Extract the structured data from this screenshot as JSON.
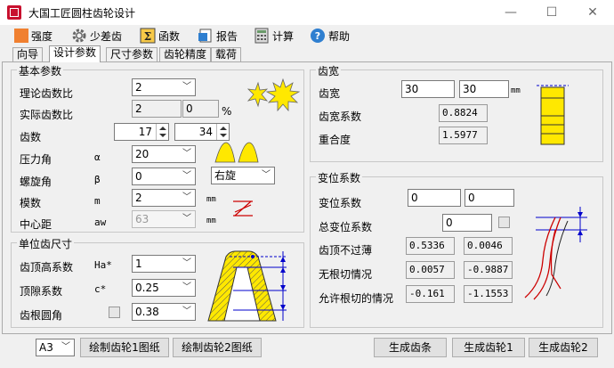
{
  "window": {
    "title": "大国工匠圆柱齿轮设计"
  },
  "toolbar": [
    {
      "label": "强度",
      "icon": "orange-square-icon"
    },
    {
      "label": "少差齿",
      "icon": "gear-icon"
    },
    {
      "label": "函数",
      "icon": "sigma-icon"
    },
    {
      "label": "报告",
      "icon": "report-icon"
    },
    {
      "label": "计算",
      "icon": "calculator-icon"
    },
    {
      "label": "帮助",
      "icon": "help-icon"
    }
  ],
  "tabs": [
    "向导",
    "设计参数",
    "尺寸参数",
    "齿轮精度",
    "载荷"
  ],
  "basic": {
    "title": "基本参数",
    "ratio_theory_label": "理论齿数比",
    "ratio_theory_value": "2",
    "ratio_actual_label": "实际齿数比",
    "ratio_actual_value": "2",
    "ratio_actual_pct": "0",
    "pct_unit": "%",
    "teeth_label": "齿数",
    "teeth_1": "17",
    "teeth_2": "34",
    "pressure_label": "压力角",
    "pressure_sym": "α",
    "pressure_value": "20",
    "helix_label": "螺旋角",
    "helix_sym": "β",
    "helix_value": "0",
    "hand_value": "右旋",
    "module_label": "模数",
    "module_sym": "m",
    "module_value": "2",
    "module_unit": "mm",
    "center_label": "中心距",
    "center_sym": "aw",
    "center_value": "63",
    "center_unit": "mm"
  },
  "unit_tooth": {
    "title": "单位齿尺寸",
    "addendum_label": "齿顶高系数",
    "addendum_sym": "Ha*",
    "addendum_value": "1",
    "clearance_label": "顶隙系数",
    "clearance_sym": "c*",
    "clearance_value": "0.25",
    "fillet_label": "齿根圆角",
    "fillet_value": "0.38"
  },
  "facewidth": {
    "title": "齿宽",
    "width_label": "齿宽",
    "width_1": "30",
    "width_2": "30",
    "width_unit": "mm",
    "coef_label": "齿宽系数",
    "coef_value": "0.8824",
    "overlap_label": "重合度",
    "overlap_value": "1.5977"
  },
  "shift": {
    "title": "变位系数",
    "shift_label": "变位系数",
    "shift_1": "0",
    "shift_2": "0",
    "total_label": "总变位系数",
    "total_value": "0",
    "tip_label": "齿顶不过薄",
    "tip_1": "0.5336",
    "tip_2": "0.0046",
    "undercut_label": "无根切情况",
    "undercut_1": "0.0057",
    "undercut_2": "-0.9887",
    "allow_label": "允许根切的情况",
    "allow_1": "-0.161",
    "allow_2": "-1.1553"
  },
  "bottom": {
    "paper": "A3",
    "draw1": "绘制齿轮1图纸",
    "draw2": "绘制齿轮2图纸",
    "gen_rack": "生成齿条",
    "gen_g1": "生成齿轮1",
    "gen_g2": "生成齿轮2"
  }
}
